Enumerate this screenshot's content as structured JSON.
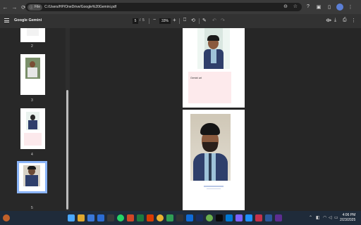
{
  "browser": {
    "back_icon": "back-arrow-icon",
    "chip_label": "File",
    "url": "C:/Users/HP/OneDrive/Google%20Gemini.pdf"
  },
  "pdf_toolbar": {
    "title": "Google Gemini",
    "current_page": "5",
    "separator": "/",
    "total_pages": "5",
    "zoom": "33%"
  },
  "thumbnails": [
    {
      "label": "2"
    },
    {
      "label": "3"
    },
    {
      "label": "4"
    },
    {
      "label": "5"
    }
  ],
  "page4_caption": "Gemini art",
  "clock": {
    "time": "4:06 PM",
    "date": "2/23/2025"
  },
  "colors": {
    "accent": "#8ab4f8",
    "suit": "#2f3f6b"
  }
}
